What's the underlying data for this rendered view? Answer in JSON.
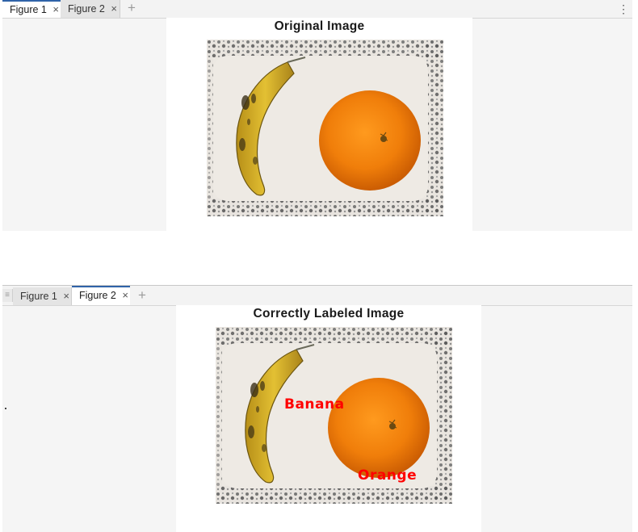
{
  "top_window": {
    "tabs": [
      {
        "label": "Figure 1",
        "active": true
      },
      {
        "label": "Figure 2",
        "active": false
      }
    ],
    "add_tab_symbol": "+",
    "more_symbol": "⋮",
    "figure_title": "Original Image"
  },
  "bottom_window": {
    "tabs": [
      {
        "label": "Figure 1",
        "active": false
      },
      {
        "label": "Figure 2",
        "active": true
      }
    ],
    "add_tab_symbol": "+",
    "figure_title": "Correctly Labeled Image",
    "labels": {
      "banana": "Banana",
      "orange": "Orange"
    }
  },
  "colors": {
    "accent_tab": "#2f63a8",
    "label_text": "#ff0000",
    "panel_bg": "#f5f5f5"
  },
  "icons": [
    "close-icon",
    "add-tab-icon",
    "more-options-icon"
  ]
}
